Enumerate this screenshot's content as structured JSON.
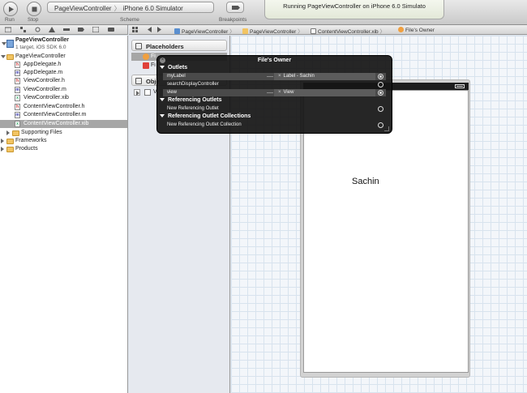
{
  "toolbar": {
    "run_label": "Run",
    "stop_label": "Stop",
    "scheme": {
      "target": "PageViewController",
      "separator": "〉",
      "destination": "iPhone 6.0 Simulator"
    },
    "scheme_label": "Scheme",
    "breakpoints_label": "Breakpoints",
    "status_text": "Running PageViewController on iPhone 6.0 Simulato"
  },
  "jump_bar": {
    "crumbs": [
      "PageViewController",
      "PageViewController",
      "ContentViewController.xib",
      "File's Owner"
    ],
    "separator": "〉"
  },
  "navigator": {
    "project": {
      "name": "PageViewController",
      "subtitle": "1 target, iOS SDK 6.0"
    },
    "items": [
      {
        "label": "PageViewController",
        "kind": "folder"
      },
      {
        "label": "AppDelegate.h",
        "kind": "h"
      },
      {
        "label": "AppDelegate.m",
        "kind": "m"
      },
      {
        "label": "ViewController.h",
        "kind": "h"
      },
      {
        "label": "ViewController.m",
        "kind": "m"
      },
      {
        "label": "ViewController.xib",
        "kind": "xib"
      },
      {
        "label": "ContentViewController.h",
        "kind": "h"
      },
      {
        "label": "ContentViewController.m",
        "kind": "m"
      },
      {
        "label": "ContentViewController.xib",
        "kind": "xib"
      },
      {
        "label": "Supporting Files",
        "kind": "folder"
      },
      {
        "label": "Frameworks",
        "kind": "folder"
      },
      {
        "label": "Products",
        "kind": "folder"
      }
    ],
    "icon_letters": {
      "h": "h",
      "m": "m",
      "xib": "x"
    }
  },
  "outline": {
    "placeholders_label": "Placeholders",
    "placeholder_items": [
      "Fi",
      "Fi"
    ],
    "objects_label": "Obje",
    "object_items": [
      "V"
    ]
  },
  "hud": {
    "title": "File's Owner",
    "close_glyph": "×",
    "sections": [
      {
        "title": "Outlets",
        "rows": [
          {
            "name": "myLabel",
            "target": "Label - Sachin",
            "connected": true
          },
          {
            "name": "searchDisplayController",
            "target": "",
            "connected": false
          },
          {
            "name": "view",
            "target": "View",
            "connected": true
          }
        ]
      },
      {
        "title": "Referencing Outlets",
        "rows": [
          {
            "name": "New Referencing Outlet",
            "target": "",
            "connected": false
          }
        ]
      },
      {
        "title": "Referencing Outlet Collections",
        "rows": [
          {
            "name": "New Referencing Outlet Collection",
            "target": "",
            "connected": false
          }
        ]
      }
    ],
    "target_remove_glyph": "×"
  },
  "canvas": {
    "label_text": "Sachin"
  },
  "colors": {
    "selection": "#a6a6a6",
    "hud_background": "#161616",
    "grid": "#d8e3ee"
  }
}
